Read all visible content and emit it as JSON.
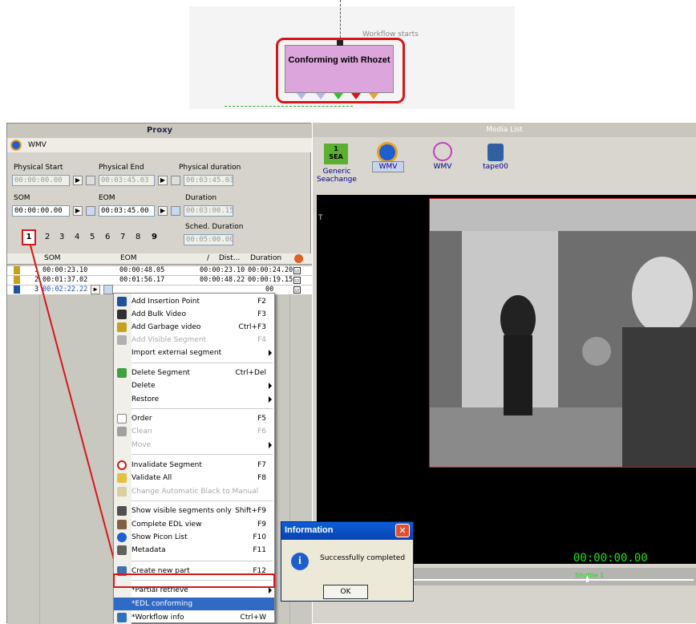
{
  "workflow": {
    "label": "Workflow starts",
    "node_title": "Conforming with Rhozet"
  },
  "proxy": {
    "title": "Proxy",
    "format": "WMV",
    "physical_start_label": "Physical Start",
    "physical_start": "00:00:00.00",
    "physical_end_label": "Physical End",
    "physical_end": "00:03:45.03",
    "physical_duration_label": "Physical duration",
    "physical_duration": "00:03:45.03",
    "som_label": "SOM",
    "som": "00:00:00.00",
    "eom_label": "EOM",
    "eom": "00:03:45.00",
    "duration_label": "Duration",
    "duration": "00:03:00.15",
    "sched_duration_label": "Sched. Duration",
    "sched_duration": "00:05:00.00",
    "play_glyph": "▶",
    "pages": [
      "1",
      "2",
      "3",
      "4",
      "5",
      "6",
      "7",
      "8",
      "9"
    ]
  },
  "table": {
    "headers": {
      "som": "SOM",
      "eom": "EOM",
      "sort": "/",
      "dist": "Dist...",
      "duration": "Duration"
    },
    "rows": [
      {
        "n": "1",
        "som": "00:00:23.10",
        "eom": "00:00:48.05",
        "dist": "00:00:23.10",
        "duration": "00:00:24.20"
      },
      {
        "n": "2",
        "som": "00:01:37.02",
        "eom": "00:01:56.17",
        "dist": "00:00:48.22",
        "duration": "00:00:19.15"
      },
      {
        "n": "3",
        "som": "00:02:22.22",
        "duration": "00"
      }
    ],
    "check": "☑"
  },
  "menu": {
    "items": [
      {
        "label": "Add Insertion Point",
        "shortcut": "F2"
      },
      {
        "label": "Add Bulk Video",
        "shortcut": "F3"
      },
      {
        "label": "Add Garbage video",
        "shortcut": "Ctrl+F3"
      },
      {
        "label": "Add Visible Segment",
        "shortcut": "F4"
      },
      {
        "label": "Import external segment",
        "shortcut": ""
      },
      {
        "label": "Delete Segment",
        "shortcut": "Ctrl+Del"
      },
      {
        "label": "Delete",
        "shortcut": ""
      },
      {
        "label": "Restore",
        "shortcut": ""
      },
      {
        "label": "Order",
        "shortcut": "F5"
      },
      {
        "label": "Clean",
        "shortcut": "F6"
      },
      {
        "label": "Move",
        "shortcut": ""
      },
      {
        "label": "Invalidate Segment",
        "shortcut": "F7"
      },
      {
        "label": "Validate All",
        "shortcut": "F8"
      },
      {
        "label": "Change Automatic Black to Manual",
        "shortcut": ""
      },
      {
        "label": "Show visible segments only",
        "shortcut": "Shift+F9"
      },
      {
        "label": "Complete EDL view",
        "shortcut": "F9"
      },
      {
        "label": "Show Picon List",
        "shortcut": "F10"
      },
      {
        "label": "Metadata",
        "shortcut": "F11"
      },
      {
        "label": "Create new part",
        "shortcut": "F12"
      },
      {
        "label": "*Partial retrieve",
        "shortcut": ""
      },
      {
        "label": "*EDL conforming",
        "shortcut": ""
      },
      {
        "label": "*Workflow info",
        "shortcut": "Ctrl+W"
      }
    ]
  },
  "media": {
    "title": "Media List",
    "tools": [
      {
        "label": "Generic\nSeachange",
        "badge": "1\nSEA"
      },
      {
        "label": "WMV"
      },
      {
        "label": "WMV"
      },
      {
        "label": "tape00"
      }
    ],
    "t_marker": "T",
    "timecode": "00:00:00.00",
    "shuttle": "Shuttle 1"
  },
  "dialog": {
    "title": "Information",
    "message": "Successfully completed",
    "ok": "OK",
    "close_glyph": "✕",
    "info_glyph": "i"
  },
  "colors": {
    "highlight": "#d8161a",
    "node": "#dca6dc",
    "timecode": "#1ee01e"
  }
}
